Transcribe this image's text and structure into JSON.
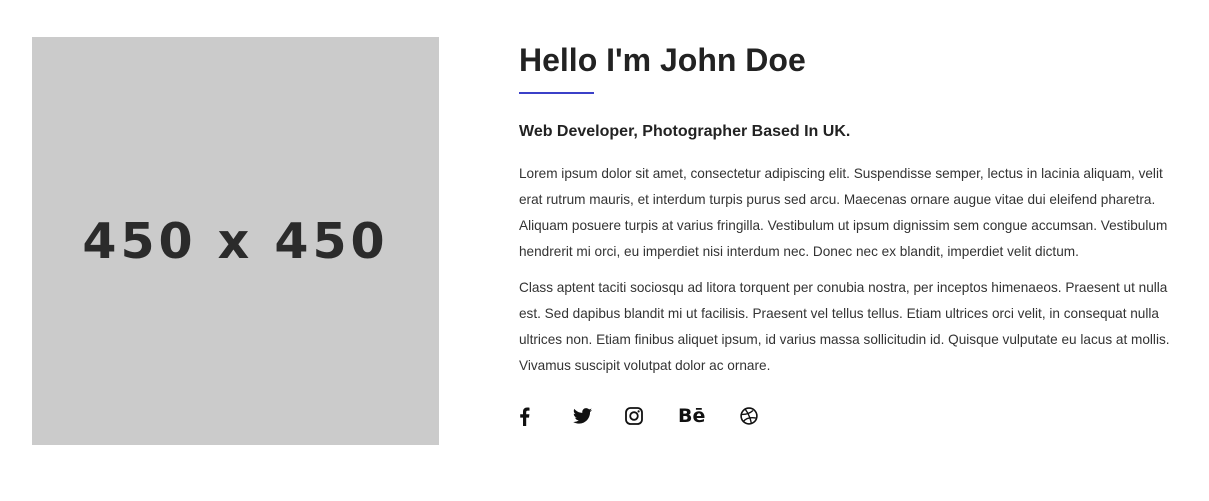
{
  "image": {
    "placeholder_text": "450 x 450"
  },
  "about": {
    "title": "Hello I'm John Doe",
    "subtitle": "Web Developer, Photographer Based In UK.",
    "paragraphs": [
      "Lorem ipsum dolor sit amet, consectetur adipiscing elit. Suspendisse semper, lectus in lacinia aliquam, velit erat rutrum mauris, et interdum turpis purus sed arcu. Maecenas ornare augue vitae dui eleifend pharetra. Aliquam posuere turpis at varius fringilla. Vestibulum ut ipsum dignissim sem congue accumsan. Vestibulum hendrerit mi orci, eu imperdiet nisi interdum nec. Donec nec ex blandit, imperdiet velit dictum.",
      "Class aptent taciti sociosqu ad litora torquent per conubia nostra, per inceptos himenaeos. Praesent ut nulla est. Sed dapibus blandit mi ut facilisis. Praesent vel tellus tellus. Etiam ultrices orci velit, in consequat nulla ultrices non. Etiam finibus aliquet ipsum, id varius massa sollicitudin id. Quisque vulputate eu lacus at mollis. Vivamus suscipit volutpat dolor ac ornare."
    ]
  },
  "social": {
    "icons": [
      "facebook-icon",
      "twitter-icon",
      "instagram-icon",
      "behance-icon",
      "dribbble-icon"
    ],
    "behance_glyph": "Bē"
  },
  "colors": {
    "accent": "#3b40c8",
    "placeholder_bg": "#cbcbcb",
    "placeholder_text": "#2b2b2b",
    "heading": "#222222",
    "body_text": "#333333"
  }
}
